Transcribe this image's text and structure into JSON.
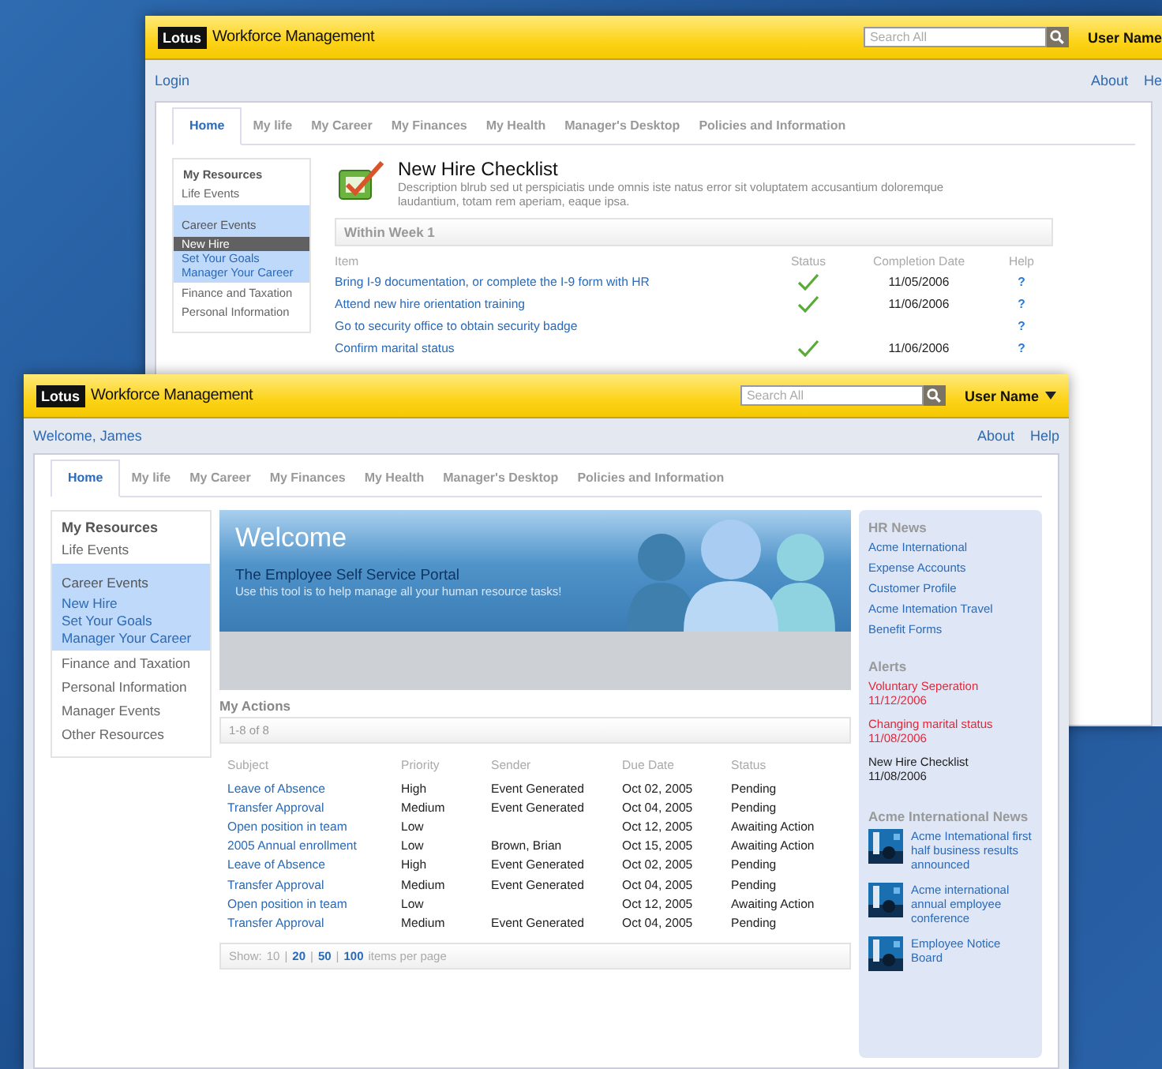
{
  "background_window": {
    "logo": "Lotus",
    "title": "Workforce Management",
    "search": {
      "placeholder": "Search All"
    },
    "user_menu": "User Name",
    "greeting": "Login",
    "links": [
      "About",
      "He"
    ],
    "tabs": [
      {
        "label": "Home",
        "selected": true
      },
      {
        "label": "My life",
        "selected": false
      },
      {
        "label": "My Career",
        "selected": false
      },
      {
        "label": "My Finances",
        "selected": false
      },
      {
        "label": "My Health",
        "selected": false
      },
      {
        "label": "Manager's Desktop",
        "selected": false
      },
      {
        "label": "Policies and Information",
        "selected": false
      }
    ],
    "sidebar": {
      "heading": "My Resources",
      "items": [
        {
          "label": "Life Events"
        },
        {
          "label": "Career Events",
          "expanded": true,
          "children": [
            {
              "label": "New Hire",
              "selected": true
            },
            {
              "label": "Set Your Goals",
              "selected": false
            },
            {
              "label": "Manager Your Career",
              "selected": false
            }
          ]
        },
        {
          "label": "Finance and Taxation"
        },
        {
          "label": "Personal Information"
        }
      ]
    },
    "checklist": {
      "title": "New Hire Checklist",
      "description": "Description blrub sed ut perspiciatis unde omnis iste natus error sit voluptatem accusantium doloremque laudantium, totam rem aperiam, eaque ipsa.",
      "section": "Within Week 1",
      "columns": [
        "Item",
        "Status",
        "Completion Date",
        "Help"
      ],
      "rows": [
        {
          "item": "Bring I-9 documentation, or complete the I-9 form with HR",
          "done": true,
          "date": "11/05/2006",
          "help": "?"
        },
        {
          "item": "Attend new hire orientation training",
          "done": true,
          "date": "11/06/2006",
          "help": "?"
        },
        {
          "item": "Go to security office to obtain security badge",
          "done": false,
          "help": "?"
        },
        {
          "item": "Confirm marital status",
          "done": true,
          "date": "11/06/2006",
          "help": "?"
        }
      ]
    }
  },
  "front_window": {
    "logo": "Lotus",
    "title": "Workforce Management",
    "search": {
      "placeholder": "Search All"
    },
    "user_menu": "User Name",
    "greeting": "Welcome, James",
    "links": [
      "About",
      "Help"
    ],
    "tabs": [
      {
        "label": "Home",
        "selected": true
      },
      {
        "label": "My life",
        "selected": false
      },
      {
        "label": "My Career",
        "selected": false
      },
      {
        "label": "My Finances",
        "selected": false
      },
      {
        "label": "My Health",
        "selected": false
      },
      {
        "label": "Manager's Desktop",
        "selected": false
      },
      {
        "label": "Policies and Information",
        "selected": false
      }
    ],
    "sidebar": {
      "heading": "My Resources",
      "items": [
        {
          "label": "Life Events"
        },
        {
          "label": "Career Events",
          "expanded": true,
          "children": [
            {
              "label": "New Hire",
              "selected": false
            },
            {
              "label": "Set Your Goals",
              "selected": false
            },
            {
              "label": "Manager Your Career",
              "selected": false
            }
          ]
        },
        {
          "label": "Finance and Taxation"
        },
        {
          "label": "Personal Information"
        },
        {
          "label": "Manager Events"
        },
        {
          "label": "Other Resources"
        }
      ]
    },
    "banner": {
      "title": "Welcome",
      "subtitle": "The Employee Self Service Portal",
      "tagline": "Use this tool is to help manage all your human resource tasks!"
    },
    "actions": {
      "title": "My Actions",
      "count": "1-8 of 8",
      "columns": [
        "Subject",
        "Priority",
        "Sender",
        "Due Date",
        "Status"
      ],
      "rows": [
        [
          "Leave of Absence",
          "High",
          "Event Generated",
          "Oct 02, 2005",
          "Pending"
        ],
        [
          "Transfer Approval",
          "Medium",
          "Event Generated",
          "Oct 04, 2005",
          "Pending"
        ],
        [
          "Open position in team",
          "Low",
          "",
          "Oct 12, 2005",
          "Awaiting Action"
        ],
        [
          "2005 Annual enrollment",
          "Low",
          "Brown, Brian",
          "Oct 15, 2005",
          "Awaiting Action"
        ],
        [
          "Leave of Absence",
          "High",
          "Event Generated",
          "Oct 02, 2005",
          "Pending"
        ],
        [
          "Transfer Approval",
          "Medium",
          "Event Generated",
          "Oct 04, 2005",
          "Pending"
        ],
        [
          "Open position in team",
          "Low",
          "",
          "Oct 12, 2005",
          "Awaiting Action"
        ],
        [
          "Transfer Approval",
          "Medium",
          "Event Generated",
          "Oct 04, 2005",
          "Pending"
        ]
      ],
      "pager": {
        "label": "Show:",
        "separator": "|",
        "options": [
          {
            "label": "10",
            "selected": true
          },
          {
            "label": "20",
            "selected": false
          },
          {
            "label": "50",
            "selected": false
          },
          {
            "label": "100",
            "selected": false
          }
        ],
        "suffix": "items per page"
      }
    },
    "hr_news": {
      "title": "HR News",
      "links": [
        "Acme International",
        "Expense Accounts",
        "Customer Profile",
        "Acme Intemation Travel",
        "Benefit Forms"
      ]
    },
    "alerts": {
      "title": "Alerts",
      "items": [
        {
          "text": "Voluntary Seperation",
          "date": "11/12/2006",
          "urgent": true
        },
        {
          "text": "Changing marital status",
          "date": "11/08/2006",
          "urgent": true
        },
        {
          "text": "New Hire Checklist",
          "date": "11/08/2006",
          "urgent": false
        }
      ]
    },
    "news": {
      "title": "Acme International News",
      "items": [
        {
          "text": "Acme Intemational first half business results announced",
          "kind": "picture"
        },
        {
          "text": "Acme international annual employee conference",
          "kind": "picture"
        },
        {
          "text": "Employee Notice Board",
          "kind": "picture"
        }
      ]
    }
  }
}
